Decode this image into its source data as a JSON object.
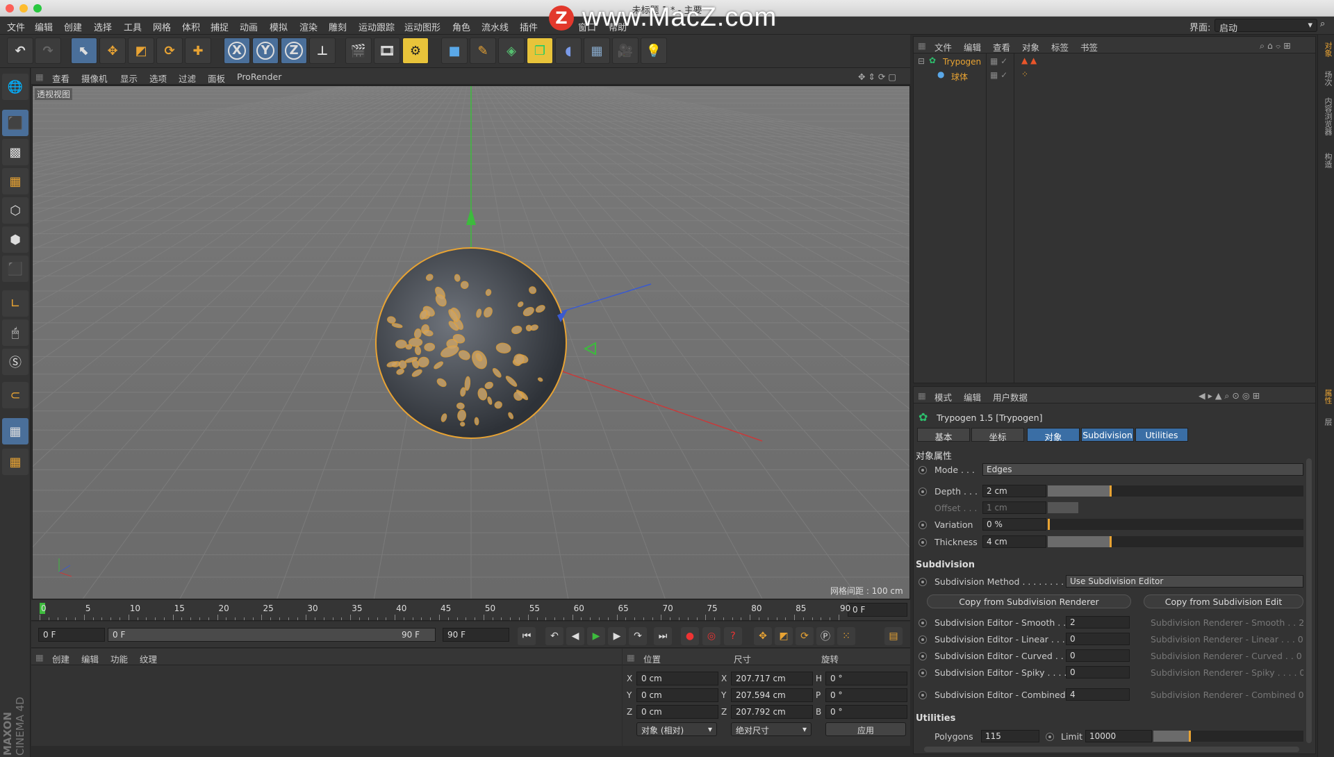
{
  "window": {
    "title": "未标题 1 * - 主要",
    "watermark": "www.MacZ.com",
    "watermark_logo": "Z"
  },
  "menu": {
    "items": [
      "文件",
      "编辑",
      "创建",
      "选择",
      "工具",
      "网格",
      "体积",
      "捕捉",
      "动画",
      "模拟",
      "渲染",
      "雕刻",
      "运动跟踪",
      "运动图形",
      "角色",
      "流水线",
      "插件",
      "窗口",
      "帮助"
    ],
    "layout_label": "界面:",
    "layout_value": "启动"
  },
  "toolbar": {
    "x_label": "X",
    "y_label": "Y",
    "z_label": "Z"
  },
  "viewport": {
    "menu": [
      "查看",
      "摄像机",
      "显示",
      "选项",
      "过滤",
      "面板",
      "ProRender"
    ],
    "label": "透视视图",
    "grid_info": "网格间距 : 100 cm"
  },
  "timeline": {
    "ticks": [
      "0",
      "5",
      "10",
      "15",
      "20",
      "25",
      "30",
      "35",
      "40",
      "45",
      "50",
      "55",
      "60",
      "65",
      "70",
      "75",
      "80",
      "85",
      "90"
    ],
    "current_frame": "0 F"
  },
  "playback": {
    "start": "0 F",
    "range_start": "0 F",
    "range_end": "90 F",
    "end": "90 F"
  },
  "materials": {
    "menu": [
      "创建",
      "编辑",
      "功能",
      "纹理"
    ]
  },
  "coords": {
    "headers": {
      "position": "位置",
      "size": "尺寸",
      "rotation": "旋转"
    },
    "rows": [
      {
        "axis": "X",
        "pos": "0 cm",
        "size_axis": "X",
        "size": "207.717 cm",
        "rot_axis": "H",
        "rot": "0 °"
      },
      {
        "axis": "Y",
        "pos": "0 cm",
        "size_axis": "Y",
        "size": "207.594 cm",
        "rot_axis": "P",
        "rot": "0 °"
      },
      {
        "axis": "Z",
        "pos": "0 cm",
        "size_axis": "Z",
        "size": "207.792 cm",
        "rot_axis": "B",
        "rot": "0 °"
      }
    ],
    "mode": "对象 (相对)",
    "size_mode": "绝对尺寸",
    "apply": "应用"
  },
  "objects": {
    "menu": [
      "文件",
      "编辑",
      "查看",
      "对象",
      "标签",
      "书签"
    ],
    "items": [
      {
        "name": "Trypogen",
        "color": "#e8a333"
      },
      {
        "name": "球体",
        "color": "#e8a333"
      }
    ]
  },
  "attributes": {
    "menu": [
      "模式",
      "编辑",
      "用户数据"
    ],
    "object_title": "Trypogen 1.5 [Trypogen]",
    "tabs": [
      "基本",
      "坐标",
      "对象",
      "Subdivision",
      "Utilities"
    ],
    "section_object": "对象属性",
    "mode_label": "Mode . . .",
    "mode_value": "Edges",
    "depth_label": "Depth . . .",
    "depth_value": "2 cm",
    "depth_frac": 0.25,
    "offset_label": "Offset . . .",
    "offset_value": "1 cm",
    "variation_label": "Variation",
    "variation_value": "0 %",
    "thickness_label": "Thickness",
    "thickness_value": "4 cm",
    "thickness_frac": 0.25,
    "section_subdivision": "Subdivision",
    "subdiv_method_label": "Subdivision Method . . . . . . . . .",
    "subdiv_method_value": "Use Subdivision Editor",
    "copy_renderer": "Copy from Subdivision Renderer",
    "copy_editor": "Copy from Subdivision Edit",
    "editor_rows": [
      {
        "label": "Subdivision Editor - Smooth . .",
        "value": "2",
        "r_label": "Subdivision Renderer - Smooth . . 2"
      },
      {
        "label": "Subdivision Editor - Linear . . .",
        "value": "0",
        "r_label": "Subdivision Renderer - Linear . . . 0"
      },
      {
        "label": "Subdivision Editor - Curved . .",
        "value": "0",
        "r_label": "Subdivision Renderer - Curved . . 0"
      },
      {
        "label": "Subdivision Editor - Spiky . . . .",
        "value": "0",
        "r_label": "Subdivision Renderer - Spiky . . . . 0"
      },
      {
        "label": "Subdivision Editor - Combined",
        "value": "4",
        "r_label": "Subdivision Renderer - Combined 0"
      }
    ],
    "section_utilities": "Utilities",
    "polygons_label": "Polygons",
    "polygons_value": "115",
    "limit_label": "Limit",
    "limit_value": "10000",
    "limit_frac": 0.25
  },
  "right_strip": [
    "对象",
    "场次",
    "内容浏览器",
    "构造",
    "属性",
    "层"
  ],
  "brand": {
    "line1": "MAXON",
    "line2": "CINEMA 4D"
  },
  "colors": {
    "accent": "#e8a333",
    "blue": "#3a6ea5"
  }
}
